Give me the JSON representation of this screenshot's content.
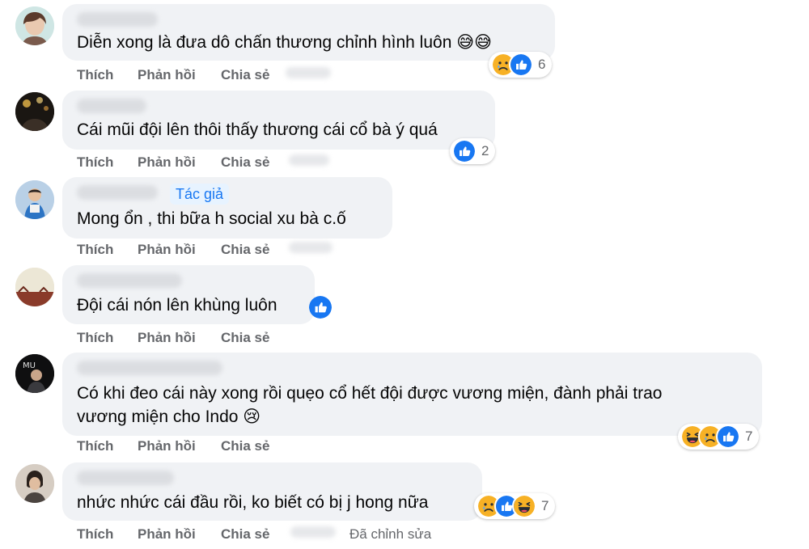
{
  "comments": [
    {
      "text": "Diễn xong là đưa dô chấn thương chỉnh hình luôn 😅😅",
      "reactions": [
        "sad",
        "like"
      ],
      "count": "6"
    },
    {
      "text": "Cái mũi đội lên thôi thấy thương cái cổ bà ý quá",
      "reactions": [
        "like"
      ],
      "count": "2"
    },
    {
      "text": "Mong ổn , thi bữa h social xu bà c.ố",
      "author_badge": "Tác giả"
    },
    {
      "text": "Đội cái nón lên khùng luôn",
      "reactions": [
        "like"
      ]
    },
    {
      "text_line1": "Có khi đeo cái này xong rồi quẹo cổ hết đội được vương miện, đành phải trao",
      "text_line2": "vương miện cho Indo 😢",
      "reactions": [
        "haha",
        "sad",
        "like"
      ],
      "count": "7"
    },
    {
      "text": "nhức nhức cái đầu rồi, ko biết có bị j hong nữa",
      "reactions": [
        "sad",
        "like",
        "haha"
      ],
      "count": "7",
      "edited": "Đã chỉnh sửa"
    }
  ],
  "actions": {
    "like": "Thích",
    "reply": "Phản hồi",
    "share": "Chia sẻ"
  },
  "colors": {
    "like": "#1877f2",
    "sad": "#f7b125",
    "haha": "#f7b125",
    "bubble": "#f0f2f5",
    "meta": "#65676b"
  }
}
